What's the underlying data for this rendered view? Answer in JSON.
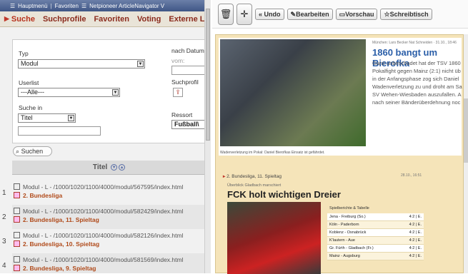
{
  "topbar": {
    "hauptmenu": "Hauptmenü",
    "favoriten": "Favoriten",
    "navigator": "Netpioneer ArticleNavigator V"
  },
  "tabs": [
    "Suche",
    "Suchprofile",
    "Favoriten",
    "Voting",
    "Externe Li"
  ],
  "form": {
    "typ_label": "Typ",
    "typ_value": "Modul",
    "userlist_label": "Userlist",
    "userlist_value": "---Alle---",
    "suchein_label": "Suche in",
    "suchein_value": "Titel",
    "nachdatum_label": "nach Datum",
    "vom_label": "vom:",
    "suchprofil_label": "Suchprofil",
    "ressort_label": "Ressort",
    "ressort_value": "Fußball\\"
  },
  "search_button": "Suchen",
  "list": {
    "header": "Titel",
    "rows": [
      {
        "num": "1",
        "path": "Modul - L - /1000/1020/1100/4000/modul/567595/index.html",
        "title": "2. Bundesliga"
      },
      {
        "num": "2",
        "path": "Modul - L - /1000/1020/1100/4000/modul/582429/index.html",
        "title": "2. Bundesliga, 11. Spieltag"
      },
      {
        "num": "3",
        "path": "Modul - L - /1000/1020/1100/4000/modul/582126/index.html",
        "title": "2. Bundesliga, 10. Spieltag"
      },
      {
        "num": "4",
        "path": "Modul - L - /1000/1020/1100/4000/modul/581569/index.html",
        "title": "2. Bundesliga, 9. Spieltag"
      }
    ]
  },
  "toolbar": {
    "undo": "Undo",
    "bearbeiten": "Bearbeiten",
    "vorschau": "Vorschau",
    "schreibtisch": "Schreibtisch"
  },
  "article1": {
    "meta": "München: Lars Becker Nat Schneiden · 31.10., 18:46",
    "headline": "1860 bangt um Bierofka",
    "body": "Ganz unbeschadet hat der TSV 1860 Pokalfight gegen Mainz (2:1) nicht üb in der Anfangsphase zog sich Daniel Wadenverletzung zu und droht am Sa SV Wehen-Wiesbaden auszufallen. A nach seiner Bänderüberdehnung noc",
    "caption": "Wadenverletzung im Pokal: Daniel Bierofkas Einsatz ist gefährdet."
  },
  "article2": {
    "kicker": "2. Bundesliga, 11. Spieltag",
    "date": "28.10., 16:51",
    "sub": "Überblick Gladbach marschiert",
    "headline": "FCK holt wichtigen Dreier",
    "table_title": "Spielberichte & Tabelle",
    "table": [
      [
        "Jena - Freiburg (So.)",
        "4:2 | E."
      ],
      [
        "Köln - Paderborn",
        "4:2 | E."
      ],
      [
        "Koblenz - Osnabrück",
        "4:2 | E."
      ],
      [
        "K'lautern - Aue",
        "4:2 | E."
      ],
      [
        "Gr. Fürth - Gladbach (Fr.)",
        "4:2 | E."
      ],
      [
        "Mainz - Augsburg",
        "4:2 | E."
      ]
    ]
  }
}
